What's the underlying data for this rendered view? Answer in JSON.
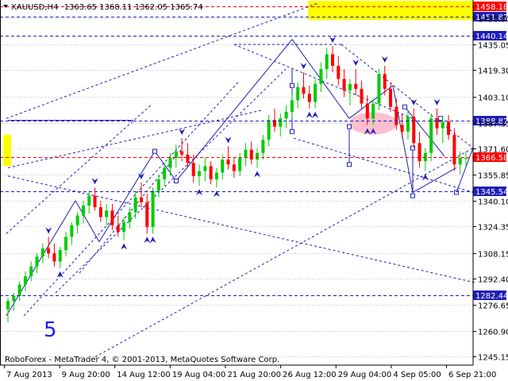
{
  "header": {
    "symbol_timeframe": "XAUUSD,H4",
    "ohlc": "1363.65 1368.11 1362.05 1365.74"
  },
  "footer": {
    "copyright": "RoboForex - MetaTrader 4, © 2001-2013, MetaQuotes Software Corp."
  },
  "annotations": {
    "wave_label": "5"
  },
  "colors": {
    "background": "#ffffff",
    "grid": "#c8c8c8",
    "bull_candle": "#00cc00",
    "bear_candle": "#ff0000",
    "channel_lines": "#1e1eb4",
    "resistance_line": "#1e1eb4",
    "support_line": "#ff0000",
    "price_box_blue": "#1e1eb4",
    "price_box_red": "#ff0000",
    "highlight_yellow": "#ffff00",
    "highlight_pink": "#ffb4c8"
  },
  "chart_data": {
    "type": "candlestick",
    "y_axis": {
      "ticks": [
        1245.15,
        1260.9,
        1276.65,
        1292.4,
        1308.15,
        1324.35,
        1340.1,
        1355.85,
        1371.6,
        1387.35,
        1403.1,
        1419.3,
        1435.05,
        1450.8
      ],
      "range": [
        1240,
        1462
      ]
    },
    "x_axis": {
      "ticks": [
        "7 Aug 2013",
        "9 Aug 20:00",
        "14 Aug 12:00",
        "19 Aug 04:00",
        "21 Aug 20:00",
        "26 Aug 12:00",
        "29 Aug 04:00",
        "4 Sep 05:00",
        "6 Sep 21:00"
      ]
    },
    "level_lines": [
      {
        "label": "1458.18",
        "value": 1458.18,
        "style": "red"
      },
      {
        "label": "1451.82",
        "value": 1451.82,
        "style": "blue"
      },
      {
        "label": "1440.14",
        "value": 1440.14,
        "style": "blue"
      },
      {
        "label": "1388.82",
        "value": 1388.82,
        "style": "blue"
      },
      {
        "label": "1366.58",
        "value": 1366.58,
        "style": "red"
      },
      {
        "label": "1345.54",
        "value": 1345.54,
        "style": "blue"
      },
      {
        "label": "1282.44",
        "value": 1282.44,
        "style": "blue"
      }
    ],
    "candles": [
      [
        1274,
        1281,
        1266,
        1279
      ],
      [
        1279,
        1284,
        1273,
        1282
      ],
      [
        1282,
        1291,
        1279,
        1289
      ],
      [
        1289,
        1297,
        1285,
        1294
      ],
      [
        1294,
        1303,
        1291,
        1300
      ],
      [
        1300,
        1308,
        1296,
        1306
      ],
      [
        1306,
        1314,
        1302,
        1311
      ],
      [
        1311,
        1318,
        1305,
        1308
      ],
      [
        1308,
        1314,
        1300,
        1303
      ],
      [
        1303,
        1312,
        1299,
        1310
      ],
      [
        1310,
        1321,
        1306,
        1318
      ],
      [
        1318,
        1327,
        1313,
        1325
      ],
      [
        1325,
        1333,
        1320,
        1331
      ],
      [
        1331,
        1340,
        1326,
        1337
      ],
      [
        1337,
        1346,
        1332,
        1343
      ],
      [
        1343,
        1348,
        1334,
        1336
      ],
      [
        1336,
        1340,
        1327,
        1330
      ],
      [
        1330,
        1338,
        1325,
        1334
      ],
      [
        1334,
        1338,
        1322,
        1325
      ],
      [
        1325,
        1331,
        1318,
        1321
      ],
      [
        1321,
        1330,
        1316,
        1327
      ],
      [
        1327,
        1336,
        1323,
        1333
      ],
      [
        1333,
        1345,
        1329,
        1342
      ],
      [
        1342,
        1351,
        1336,
        1339
      ],
      [
        1339,
        1344,
        1320,
        1324
      ],
      [
        1324,
        1348,
        1320,
        1346
      ],
      [
        1346,
        1356,
        1342,
        1353
      ],
      [
        1353,
        1363,
        1349,
        1360
      ],
      [
        1360,
        1369,
        1355,
        1366
      ],
      [
        1366,
        1374,
        1360,
        1370
      ],
      [
        1370,
        1378,
        1364,
        1368
      ],
      [
        1368,
        1375,
        1360,
        1363
      ],
      [
        1363,
        1368,
        1351,
        1355
      ],
      [
        1355,
        1362,
        1349,
        1358
      ],
      [
        1358,
        1366,
        1352,
        1361
      ],
      [
        1361,
        1364,
        1350,
        1353
      ],
      [
        1353,
        1360,
        1348,
        1357
      ],
      [
        1357,
        1368,
        1353,
        1365
      ],
      [
        1365,
        1373,
        1359,
        1362
      ],
      [
        1362,
        1366,
        1354,
        1358
      ],
      [
        1358,
        1369,
        1355,
        1366
      ],
      [
        1366,
        1375,
        1361,
        1371
      ],
      [
        1371,
        1376,
        1362,
        1365
      ],
      [
        1365,
        1372,
        1360,
        1369
      ],
      [
        1369,
        1380,
        1365,
        1377
      ],
      [
        1377,
        1392,
        1373,
        1389
      ],
      [
        1389,
        1396,
        1382,
        1385
      ],
      [
        1385,
        1393,
        1379,
        1390
      ],
      [
        1390,
        1398,
        1384,
        1394
      ],
      [
        1394,
        1405,
        1390,
        1401
      ],
      [
        1401,
        1412,
        1396,
        1409
      ],
      [
        1409,
        1418,
        1402,
        1405
      ],
      [
        1405,
        1410,
        1396,
        1400
      ],
      [
        1400,
        1414,
        1396,
        1411
      ],
      [
        1411,
        1424,
        1406,
        1420
      ],
      [
        1420,
        1433,
        1414,
        1429
      ],
      [
        1429,
        1434,
        1418,
        1422
      ],
      [
        1422,
        1428,
        1410,
        1414
      ],
      [
        1414,
        1420,
        1403,
        1407
      ],
      [
        1407,
        1414,
        1398,
        1411
      ],
      [
        1411,
        1420,
        1404,
        1408
      ],
      [
        1408,
        1413,
        1396,
        1399
      ],
      [
        1399,
        1404,
        1386,
        1390
      ],
      [
        1390,
        1402,
        1386,
        1399
      ],
      [
        1399,
        1420,
        1395,
        1417
      ],
      [
        1417,
        1422,
        1404,
        1408
      ],
      [
        1408,
        1412,
        1394,
        1397
      ],
      [
        1397,
        1402,
        1383,
        1386
      ],
      [
        1386,
        1393,
        1378,
        1382
      ],
      [
        1382,
        1394,
        1377,
        1391
      ],
      [
        1391,
        1396,
        1372,
        1375
      ],
      [
        1375,
        1382,
        1360,
        1364
      ],
      [
        1364,
        1372,
        1358,
        1369
      ],
      [
        1369,
        1393,
        1364,
        1390
      ],
      [
        1390,
        1396,
        1380,
        1384
      ],
      [
        1384,
        1391,
        1375,
        1388
      ],
      [
        1388,
        1392,
        1377,
        1380
      ],
      [
        1380,
        1384,
        1358,
        1362
      ],
      [
        1362,
        1370,
        1356,
        1366
      ],
      [
        1366,
        1370,
        1361,
        1366
      ]
    ]
  }
}
